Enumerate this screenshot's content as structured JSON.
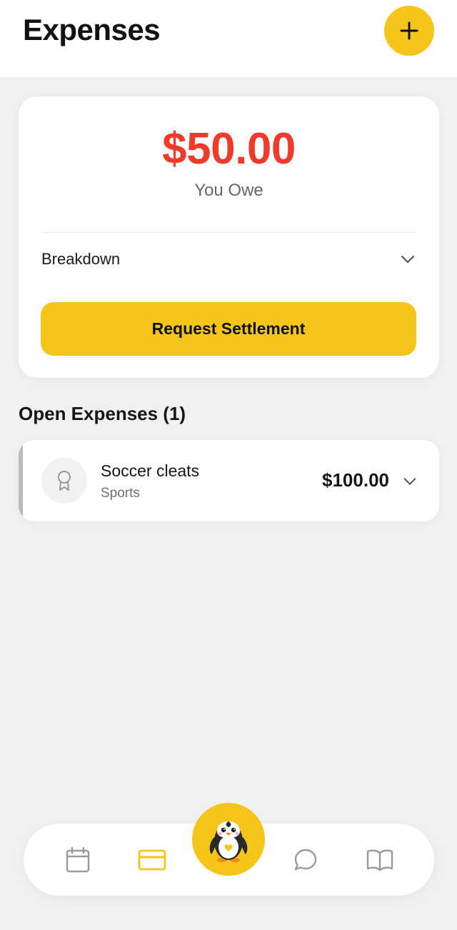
{
  "header": {
    "title": "Expenses",
    "add_icon": "plus-icon"
  },
  "summary": {
    "amount": "$50.00",
    "amount_color": "#f03b2c",
    "label": "You Owe",
    "breakdown_label": "Breakdown",
    "breakdown_icon": "chevron-down-icon",
    "settle_label": "Request Settlement"
  },
  "open_expenses": {
    "title": "Open Expenses (1)",
    "items": [
      {
        "name": "Soccer cleats",
        "category": "Sports",
        "amount": "$100.00",
        "icon": "award-ribbon-icon"
      }
    ]
  },
  "nav": {
    "items": [
      {
        "id": "calendar",
        "icon": "calendar-icon",
        "active": false
      },
      {
        "id": "expenses",
        "icon": "credit-card-icon",
        "active": true
      },
      {
        "id": "home",
        "icon": "penguin-mascot-icon",
        "active": false
      },
      {
        "id": "messages",
        "icon": "chat-bubble-icon",
        "active": false
      },
      {
        "id": "resources",
        "icon": "open-book-icon",
        "active": false
      }
    ]
  },
  "colors": {
    "accent": "#f5c51a",
    "owe": "#f03b2c",
    "background": "#f1f1f1",
    "nav_inactive": "#9a9a9a"
  }
}
